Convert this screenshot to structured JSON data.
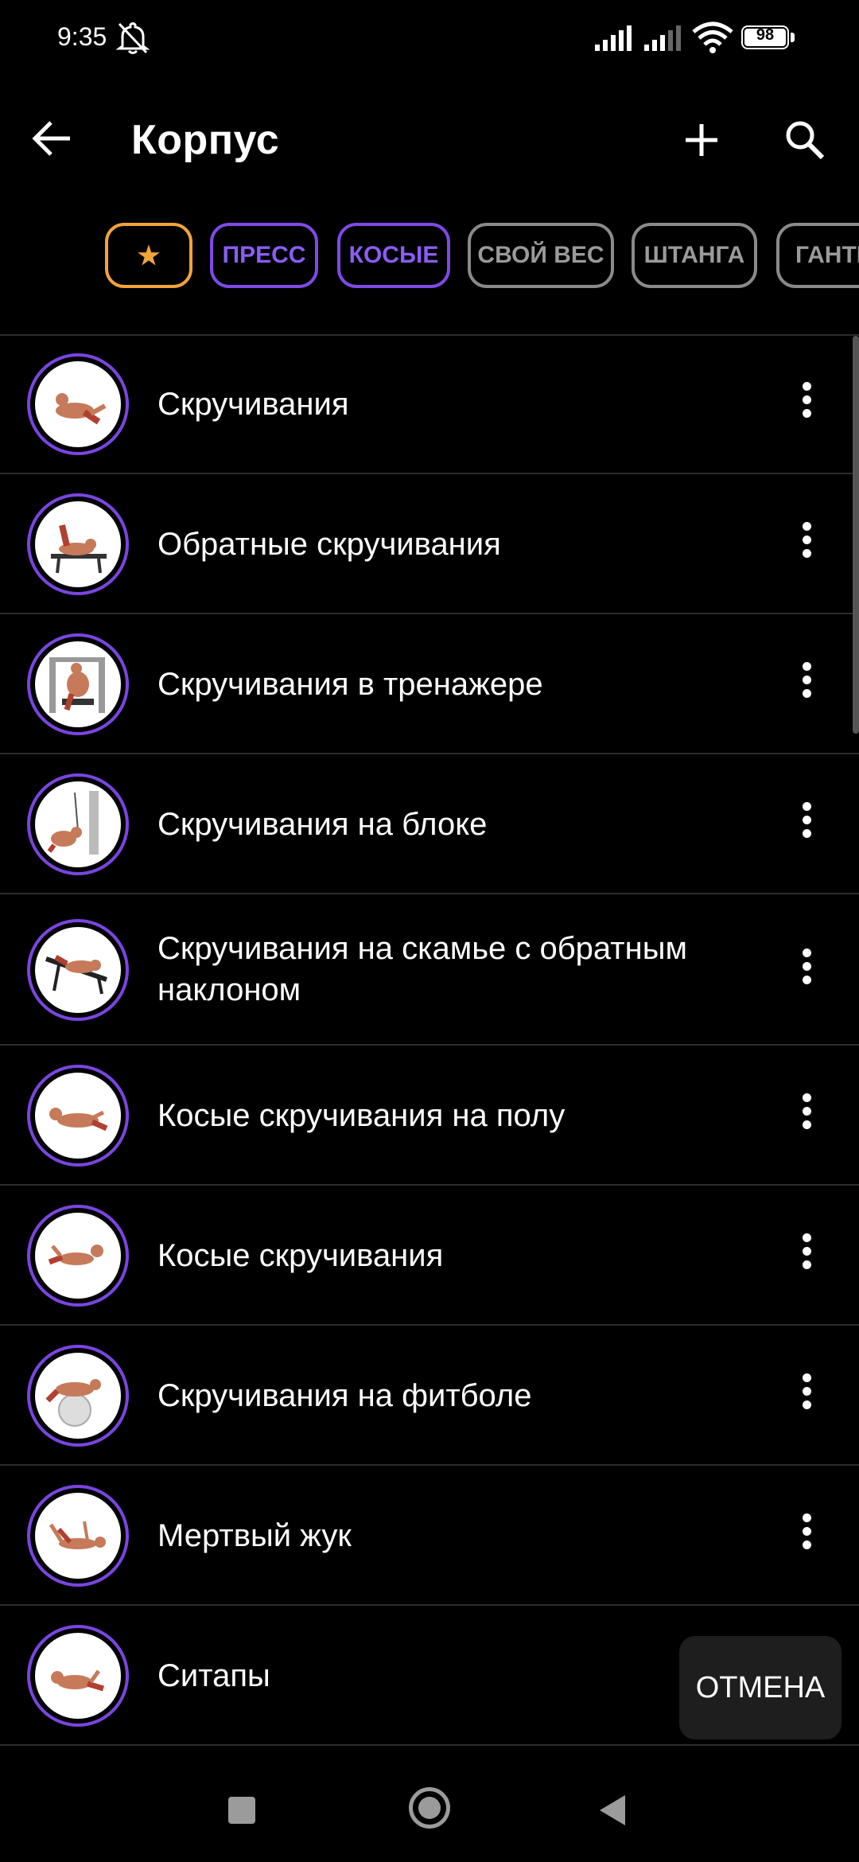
{
  "status_bar": {
    "time": "9:35",
    "battery": "98"
  },
  "header": {
    "title": "Корпус"
  },
  "chips": [
    {
      "label": "★",
      "state": "favorite"
    },
    {
      "label": "ПРЕСС",
      "state": "active"
    },
    {
      "label": "КОСЫЕ",
      "state": "active"
    },
    {
      "label": "СВОЙ ВЕС",
      "state": "inactive"
    },
    {
      "label": "ШТАНГА",
      "state": "inactive"
    },
    {
      "label": "ГАНТЕЛИ",
      "state": "inactive"
    }
  ],
  "exercises": [
    {
      "label": "Скручивания"
    },
    {
      "label": "Обратные скручивания"
    },
    {
      "label": "Скручивания в тренажере"
    },
    {
      "label": "Скручивания на блоке"
    },
    {
      "label": "Скручивания на скамье с обратным наклоном"
    },
    {
      "label": "Косые скручивания на полу"
    },
    {
      "label": "Косые скручивания"
    },
    {
      "label": "Скручивания на фитболе"
    },
    {
      "label": "Мертвый жук"
    },
    {
      "label": "Ситапы"
    }
  ],
  "cancel_button": {
    "label": "ОТМЕНА"
  },
  "colors": {
    "accent": "#7e4ae6",
    "favorite": "#f2a33a",
    "chip_inactive": "#8a8a8a"
  },
  "icons": [
    "mute-icon",
    "signal-icon",
    "wifi-icon",
    "back-arrow-icon",
    "add-icon",
    "search-icon",
    "more-vert-icon",
    "nav-recents-icon",
    "nav-home-icon",
    "nav-back-icon"
  ]
}
